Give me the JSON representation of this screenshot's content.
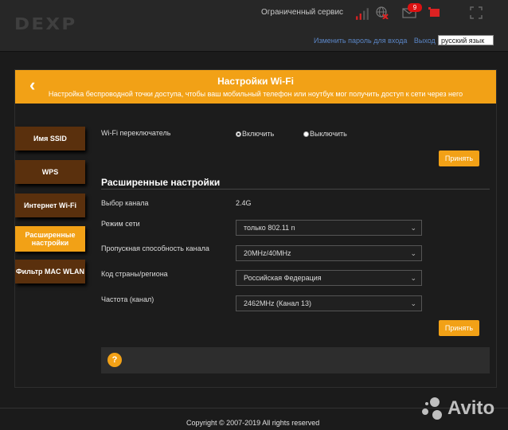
{
  "header": {
    "logo": "DEXP",
    "service_status": "Ограниченный сервис",
    "notification_count": "9",
    "change_password_link": "Изменить пароль для входа",
    "logout_link": "Выход",
    "language": "русский язык",
    "icons": [
      "signal-icon",
      "no-internet-icon",
      "notification-icon",
      "device-icon",
      "fullscreen-icon"
    ]
  },
  "banner": {
    "title": "Настройки Wi-Fi",
    "subtitle": "Настройка беспроводной точки доступа, чтобы ваш мобильный телефон или ноутбук мог получить доступ к сети через него"
  },
  "sidebar": {
    "items": [
      {
        "label": "Имя SSID",
        "active": false
      },
      {
        "label": "WPS",
        "active": false
      },
      {
        "label": "Интернет Wi-Fi",
        "active": false
      },
      {
        "label": "Расширенные настройки",
        "active": true
      },
      {
        "label": "Фильтр MAC WLAN",
        "active": false
      }
    ]
  },
  "wifi_switch": {
    "label": "Wi-Fi переключатель",
    "on_label": "Включить",
    "off_label": "Выключить",
    "selected": "on",
    "apply_label": "Принять"
  },
  "advanced": {
    "title": "Расширенные настройки",
    "channel_label": "Выбор канала",
    "channel_value": "2.4G",
    "mode_label": "Режим сети",
    "mode_value": "только 802.11 n",
    "bandwidth_label": "Пропускная способность канала",
    "bandwidth_value": "20MHz/40MHz",
    "country_label": "Код страны/региона",
    "country_value": "Российская Федерация",
    "freq_label": "Частота (канал)",
    "freq_value": "2462MHz (Канал 13)",
    "apply_label": "Принять"
  },
  "help": {
    "icon": "question-icon",
    "symbol": "?"
  },
  "footer": {
    "copyright": "Copyright © 2007-2019 All rights reserved",
    "watermark": "Avito"
  },
  "colors": {
    "accent": "#f2a116",
    "sidebar_item": "#5a300d",
    "background": "#1b1b1b"
  }
}
